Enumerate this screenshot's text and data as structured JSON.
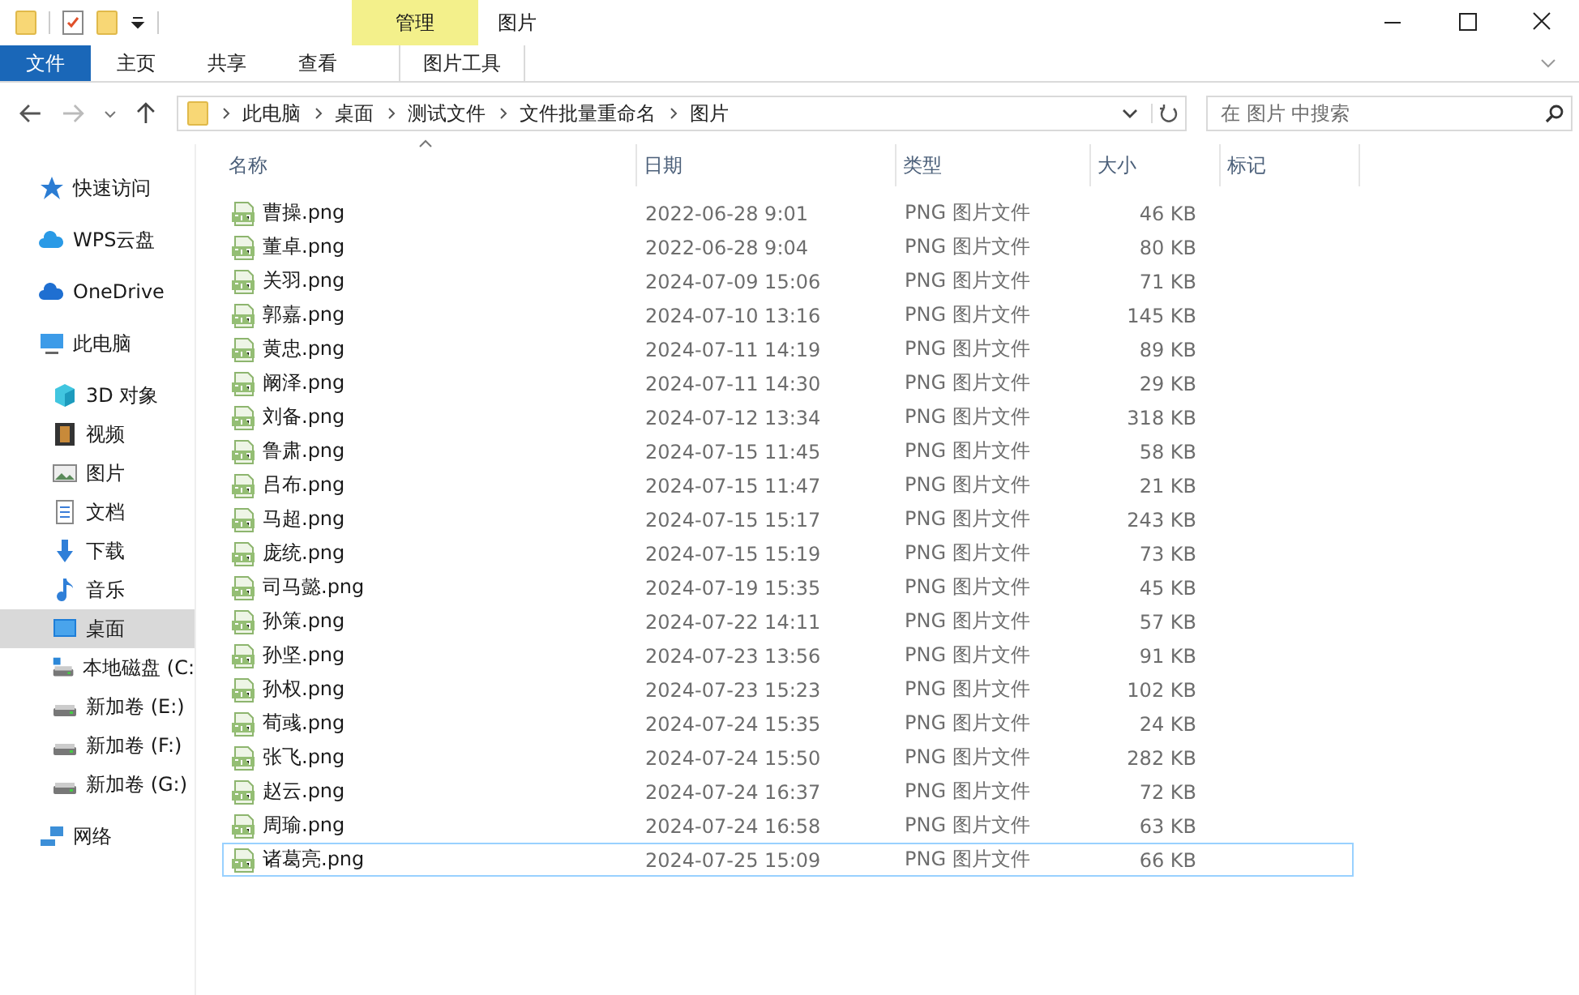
{
  "window": {
    "title": "图片",
    "context_group": "管理"
  },
  "ribbon_tabs": [
    {
      "label": "文件",
      "kind": "file",
      "selected": false
    },
    {
      "label": "主页",
      "kind": "tab",
      "selected": false
    },
    {
      "label": "共享",
      "kind": "tab",
      "selected": false
    },
    {
      "label": "查看",
      "kind": "tab",
      "selected": false
    },
    {
      "label": "图片工具",
      "kind": "context",
      "selected": false
    }
  ],
  "breadcrumb": [
    "此电脑",
    "桌面",
    "测试文件",
    "文件批量重命名",
    "图片"
  ],
  "search": {
    "placeholder": "在 图片 中搜索"
  },
  "sidebar": {
    "items": [
      {
        "label": "快速访问",
        "kind": "star",
        "selected": false
      },
      {
        "label": "WPS云盘",
        "kind": "cloud-wps",
        "selected": false
      },
      {
        "label": "OneDrive",
        "kind": "cloud",
        "selected": false
      },
      {
        "label": "此电脑",
        "kind": "pc",
        "selected": false,
        "children": [
          {
            "label": "3D 对象",
            "kind": "cube",
            "selected": false
          },
          {
            "label": "视频",
            "kind": "film",
            "selected": false
          },
          {
            "label": "图片",
            "kind": "image",
            "selected": false
          },
          {
            "label": "文档",
            "kind": "doc",
            "selected": false
          },
          {
            "label": "下载",
            "kind": "download",
            "selected": false
          },
          {
            "label": "音乐",
            "kind": "music",
            "selected": false
          },
          {
            "label": "桌面",
            "kind": "desktop",
            "selected": true
          },
          {
            "label": "本地磁盘 (C:",
            "kind": "osdrive",
            "selected": false
          },
          {
            "label": "新加卷 (E:)",
            "kind": "drive",
            "selected": false
          },
          {
            "label": "新加卷 (F:)",
            "kind": "drive",
            "selected": false
          },
          {
            "label": "新加卷 (G:)",
            "kind": "drive",
            "selected": false
          }
        ]
      },
      {
        "label": "网络",
        "kind": "network",
        "selected": false
      }
    ]
  },
  "table": {
    "columns": [
      "名称",
      "日期",
      "类型",
      "大小",
      "标记"
    ],
    "rows": [
      {
        "name": "曹操.png",
        "date": "2022-06-28 9:01",
        "type": "PNG 图片文件",
        "size": "46 KB",
        "focused": false
      },
      {
        "name": "董卓.png",
        "date": "2022-06-28 9:04",
        "type": "PNG 图片文件",
        "size": "80 KB",
        "focused": false
      },
      {
        "name": "关羽.png",
        "date": "2024-07-09 15:06",
        "type": "PNG 图片文件",
        "size": "71 KB",
        "focused": false
      },
      {
        "name": "郭嘉.png",
        "date": "2024-07-10 13:16",
        "type": "PNG 图片文件",
        "size": "145 KB",
        "focused": false
      },
      {
        "name": "黄忠.png",
        "date": "2024-07-11 14:19",
        "type": "PNG 图片文件",
        "size": "89 KB",
        "focused": false
      },
      {
        "name": "阚泽.png",
        "date": "2024-07-11 14:30",
        "type": "PNG 图片文件",
        "size": "29 KB",
        "focused": false
      },
      {
        "name": "刘备.png",
        "date": "2024-07-12 13:34",
        "type": "PNG 图片文件",
        "size": "318 KB",
        "focused": false
      },
      {
        "name": "鲁肃.png",
        "date": "2024-07-15 11:45",
        "type": "PNG 图片文件",
        "size": "58 KB",
        "focused": false
      },
      {
        "name": "吕布.png",
        "date": "2024-07-15 11:47",
        "type": "PNG 图片文件",
        "size": "21 KB",
        "focused": false
      },
      {
        "name": "马超.png",
        "date": "2024-07-15 15:17",
        "type": "PNG 图片文件",
        "size": "243 KB",
        "focused": false
      },
      {
        "name": "庞统.png",
        "date": "2024-07-15 15:19",
        "type": "PNG 图片文件",
        "size": "73 KB",
        "focused": false
      },
      {
        "name": "司马懿.png",
        "date": "2024-07-19 15:35",
        "type": "PNG 图片文件",
        "size": "45 KB",
        "focused": false
      },
      {
        "name": "孙策.png",
        "date": "2024-07-22 14:11",
        "type": "PNG 图片文件",
        "size": "57 KB",
        "focused": false
      },
      {
        "name": "孙坚.png",
        "date": "2024-07-23 13:56",
        "type": "PNG 图片文件",
        "size": "91 KB",
        "focused": false
      },
      {
        "name": "孙权.png",
        "date": "2024-07-23 15:23",
        "type": "PNG 图片文件",
        "size": "102 KB",
        "focused": false
      },
      {
        "name": "荀彧.png",
        "date": "2024-07-24 15:35",
        "type": "PNG 图片文件",
        "size": "24 KB",
        "focused": false
      },
      {
        "name": "张飞.png",
        "date": "2024-07-24 15:50",
        "type": "PNG 图片文件",
        "size": "282 KB",
        "focused": false
      },
      {
        "name": "赵云.png",
        "date": "2024-07-24 16:37",
        "type": "PNG 图片文件",
        "size": "72 KB",
        "focused": false
      },
      {
        "name": "周瑜.png",
        "date": "2024-07-24 16:58",
        "type": "PNG 图片文件",
        "size": "63 KB",
        "focused": false
      },
      {
        "name": "诸葛亮.png",
        "date": "2024-07-25 15:09",
        "type": "PNG 图片文件",
        "size": "66 KB",
        "focused": true
      }
    ]
  }
}
